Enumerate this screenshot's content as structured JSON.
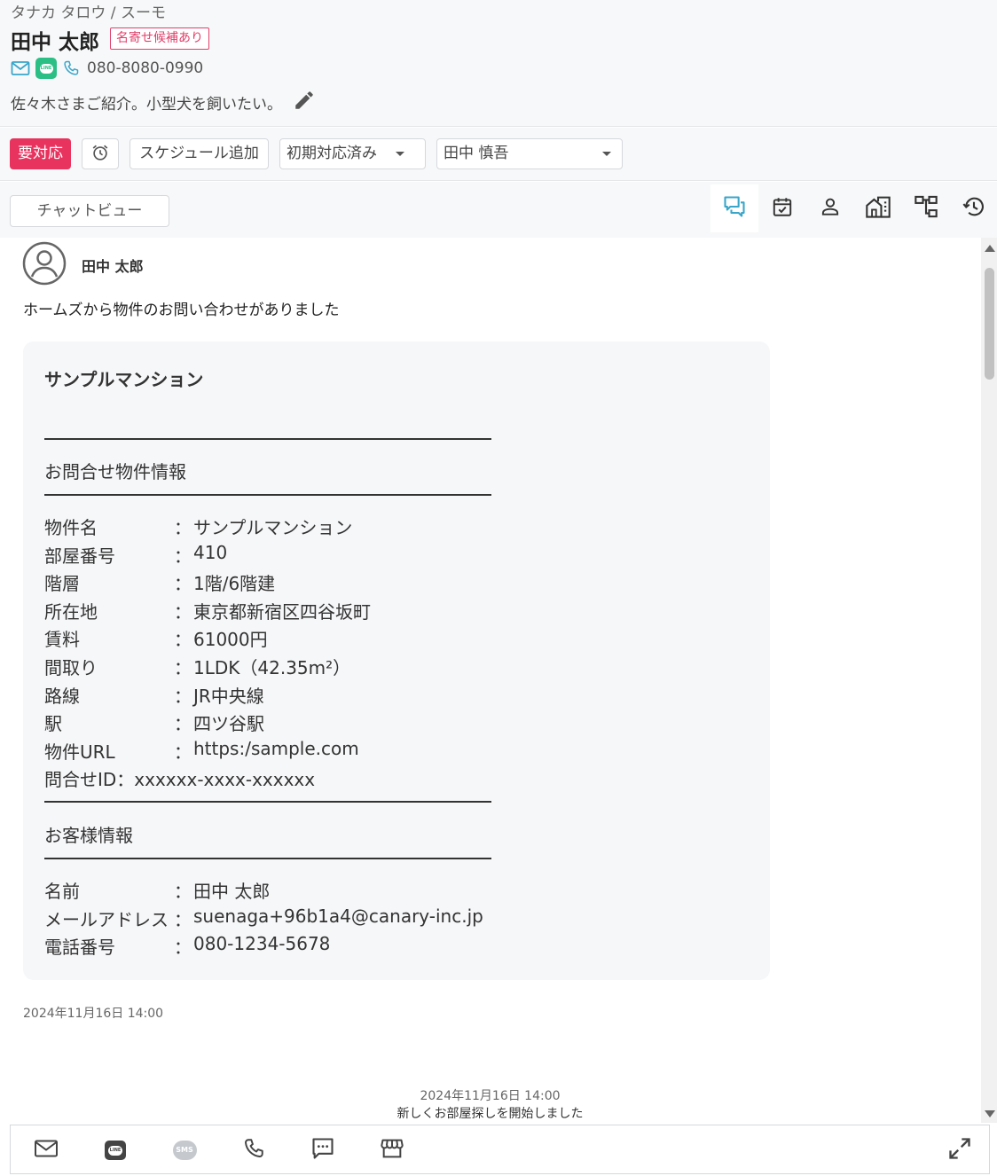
{
  "customer": {
    "kana_source": "タナカ タロウ / スーモ",
    "name": "田中 太郎",
    "badge": "名寄せ候補あり",
    "phone": "080-8080-0990",
    "memo": "佐々木さまご紹介。小型犬を飼いたい。"
  },
  "toolbar": {
    "urgent_label": "要対応",
    "schedule_label": "スケジュール追加",
    "status_value": "初期対応済み",
    "staff_value": "田中 慎吾"
  },
  "tabs": {
    "chat_view_label": "チャットビュー",
    "icons": [
      "chat-icon",
      "calendar-check-icon",
      "person-icon",
      "building-icon",
      "hierarchy-icon",
      "history-icon"
    ]
  },
  "message": {
    "sender": "田中 太郎",
    "text": "ホームズから物件のお問い合わせがありました",
    "card": {
      "title": "サンプルマンション",
      "divider": "――――――――――――――――――――――――",
      "section1": "お問合せ物件情報",
      "rows1": [
        {
          "label": "物件名",
          "value": "サンプルマンション"
        },
        {
          "label": "部屋番号",
          "value": "410"
        },
        {
          "label": "階層",
          "value": "1階/6階建"
        },
        {
          "label": "所在地",
          "value": "東京都新宿区四谷坂町"
        },
        {
          "label": "賃料",
          "value": "61000円"
        },
        {
          "label": "間取り",
          "value": "1LDK（42.35m²）"
        },
        {
          "label": "路線",
          "value": "JR中央線"
        },
        {
          "label": "駅",
          "value": "四ツ谷駅"
        },
        {
          "label": "物件URL",
          "value": "https:/sample.com"
        }
      ],
      "inquiry_id": "問合せID：xxxxxx-xxxx-xxxxxx",
      "section2": "お客様情報",
      "rows2": [
        {
          "label": "名前",
          "value": "田中 太郎"
        },
        {
          "label": "メールアドレス",
          "value": "suenaga+96b1a4@canary-inc.jp"
        },
        {
          "label": "電話番号",
          "value": "080-1234-5678"
        }
      ]
    },
    "timestamp": "2024年11月16日 14:00"
  },
  "system_message": {
    "timestamp": "2024年11月16日 14:00",
    "text": "新しくお部屋探しを開始しました"
  },
  "bottom_bar": {
    "sms_label": "SMS",
    "line_label": "LINE",
    "icons": [
      "mail-icon",
      "line-icon",
      "sms-icon",
      "phone-icon",
      "chat-dots-icon",
      "store-icon",
      "expand-icon"
    ]
  },
  "colors": {
    "accent": "#e8335e",
    "active_tab": "#4aa8c8",
    "line_green": "#2bbf86"
  }
}
